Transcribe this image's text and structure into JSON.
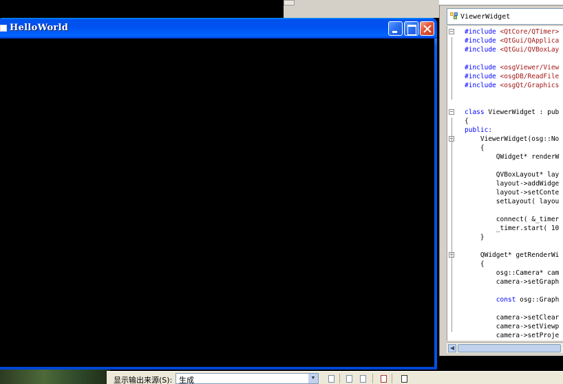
{
  "window": {
    "title": "HelloWorld",
    "buttons": {
      "minimize": "minimize",
      "maximize": "maximize",
      "close": "close"
    }
  },
  "editor": {
    "class_selector": "ViewerWidget",
    "lines": [
      {
        "text": "#include <QtCore/QTimer>",
        "kind": "include",
        "fold": "minus"
      },
      {
        "text": "#include <QtGui/QApplica",
        "kind": "include"
      },
      {
        "text": "#include <QtGui/QVBoxLay",
        "kind": "include"
      },
      {
        "text": "",
        "kind": "plain"
      },
      {
        "text": "#include <osgViewer/View",
        "kind": "include"
      },
      {
        "text": "#include <osgDB/ReadFile",
        "kind": "include"
      },
      {
        "text": "#include <osgQt/Graphics",
        "kind": "include"
      },
      {
        "text": "",
        "kind": "plain"
      },
      {
        "text": "",
        "kind": "plain"
      },
      {
        "text": "class ViewerWidget : pub",
        "kind": "class",
        "fold": "minus"
      },
      {
        "text": "{",
        "kind": "plain"
      },
      {
        "text": "public:",
        "kind": "keyword"
      },
      {
        "text": "    ViewerWidget(osg::No",
        "kind": "plain",
        "fold": "minus"
      },
      {
        "text": "    {",
        "kind": "plain"
      },
      {
        "text": "        QWidget* renderW",
        "kind": "plain"
      },
      {
        "text": "",
        "kind": "plain"
      },
      {
        "text": "        QVBoxLayout* lay",
        "kind": "plain"
      },
      {
        "text": "        layout->addWidge",
        "kind": "plain"
      },
      {
        "text": "        layout->setConte",
        "kind": "plain"
      },
      {
        "text": "        setLayout( layou",
        "kind": "plain"
      },
      {
        "text": "",
        "kind": "plain"
      },
      {
        "text": "        connect( &_timer",
        "kind": "plain"
      },
      {
        "text": "        _timer.start( 10",
        "kind": "plain"
      },
      {
        "text": "    }",
        "kind": "plain"
      },
      {
        "text": "",
        "kind": "plain"
      },
      {
        "text": "    QWidget* getRenderWi",
        "kind": "plain",
        "fold": "minus"
      },
      {
        "text": "    {",
        "kind": "plain"
      },
      {
        "text": "        osg::Camera* cam",
        "kind": "plain"
      },
      {
        "text": "        camera->setGraph",
        "kind": "plain"
      },
      {
        "text": "",
        "kind": "plain"
      },
      {
        "text": "        const osg::Graph",
        "kind": "const"
      },
      {
        "text": "",
        "kind": "plain"
      },
      {
        "text": "        camera->setClear",
        "kind": "plain"
      },
      {
        "text": "        camera->setViewp",
        "kind": "plain"
      },
      {
        "text": "        camera->setProje",
        "kind": "plain"
      }
    ]
  },
  "output": {
    "label": "显示输出来源(S):",
    "source_value": "生成"
  },
  "colors": {
    "titlebar": "#0055e5",
    "keyword": "#0000ff",
    "string": "#a31515",
    "ide_bg": "#d4d0c8"
  }
}
